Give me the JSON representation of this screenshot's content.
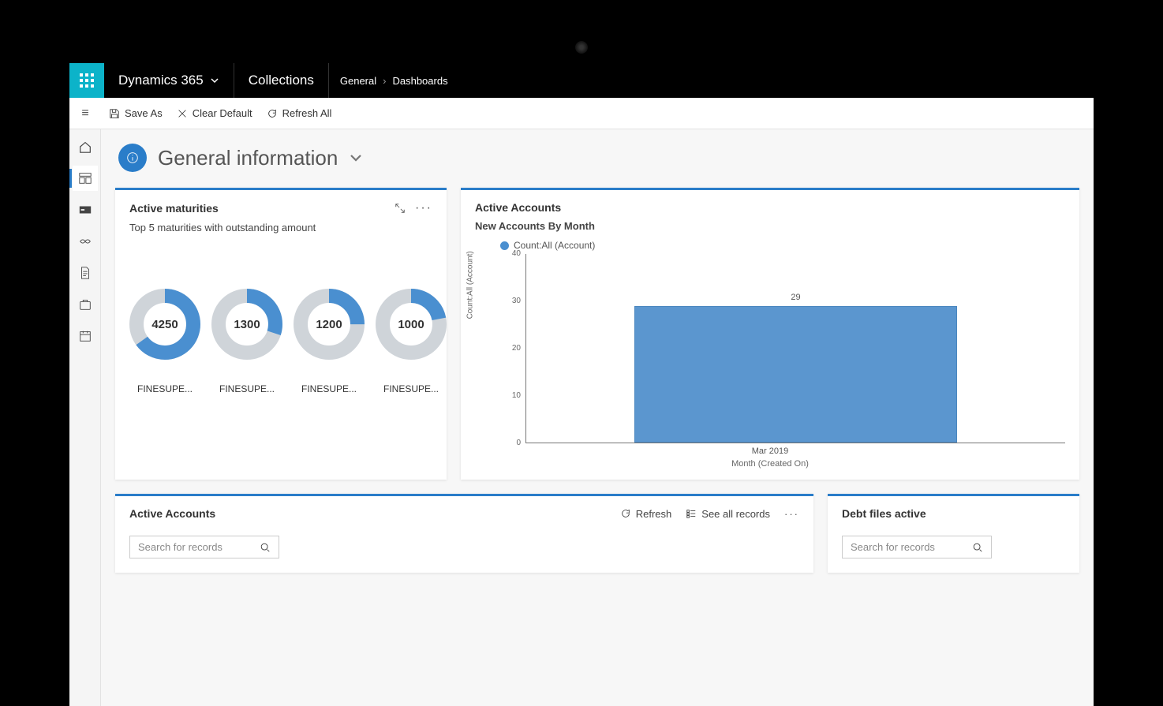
{
  "nav": {
    "app": "Dynamics 365",
    "area": "Collections",
    "crumb1": "General",
    "crumb2": "Dashboards"
  },
  "cmdbar": {
    "saveas": "Save As",
    "cleardefault": "Clear Default",
    "refreshall": "Refresh All"
  },
  "page_title": "General information",
  "widgets": {
    "maturities": {
      "title": "Active maturities",
      "subtitle": "Top 5 maturities with outstanding amount",
      "items": [
        {
          "value": "4250",
          "label": "FINESUPE...",
          "pct": 65
        },
        {
          "value": "1300",
          "label": "FINESUPE...",
          "pct": 30
        },
        {
          "value": "1200",
          "label": "FINESUPE...",
          "pct": 25
        },
        {
          "value": "1000",
          "label": "FINESUPE...",
          "pct": 22
        }
      ]
    },
    "accounts": {
      "title": "Active Accounts",
      "subtitle": "New Accounts By Month",
      "legend": "Count:All (Account)"
    }
  },
  "bottom": {
    "left_title": "Active Accounts",
    "right_title": "Debt files active",
    "refresh": "Refresh",
    "seeall": "See all records",
    "search_placeholder": "Search for records"
  },
  "chart_data": {
    "type": "bar",
    "title": "New Accounts By Month",
    "xlabel": "Month (Created On)",
    "ylabel": "Count:All (Account)",
    "ylim": [
      0,
      40
    ],
    "yticks": [
      0,
      10,
      20,
      30,
      40
    ],
    "categories": [
      "Mar 2019"
    ],
    "values": [
      29
    ]
  }
}
